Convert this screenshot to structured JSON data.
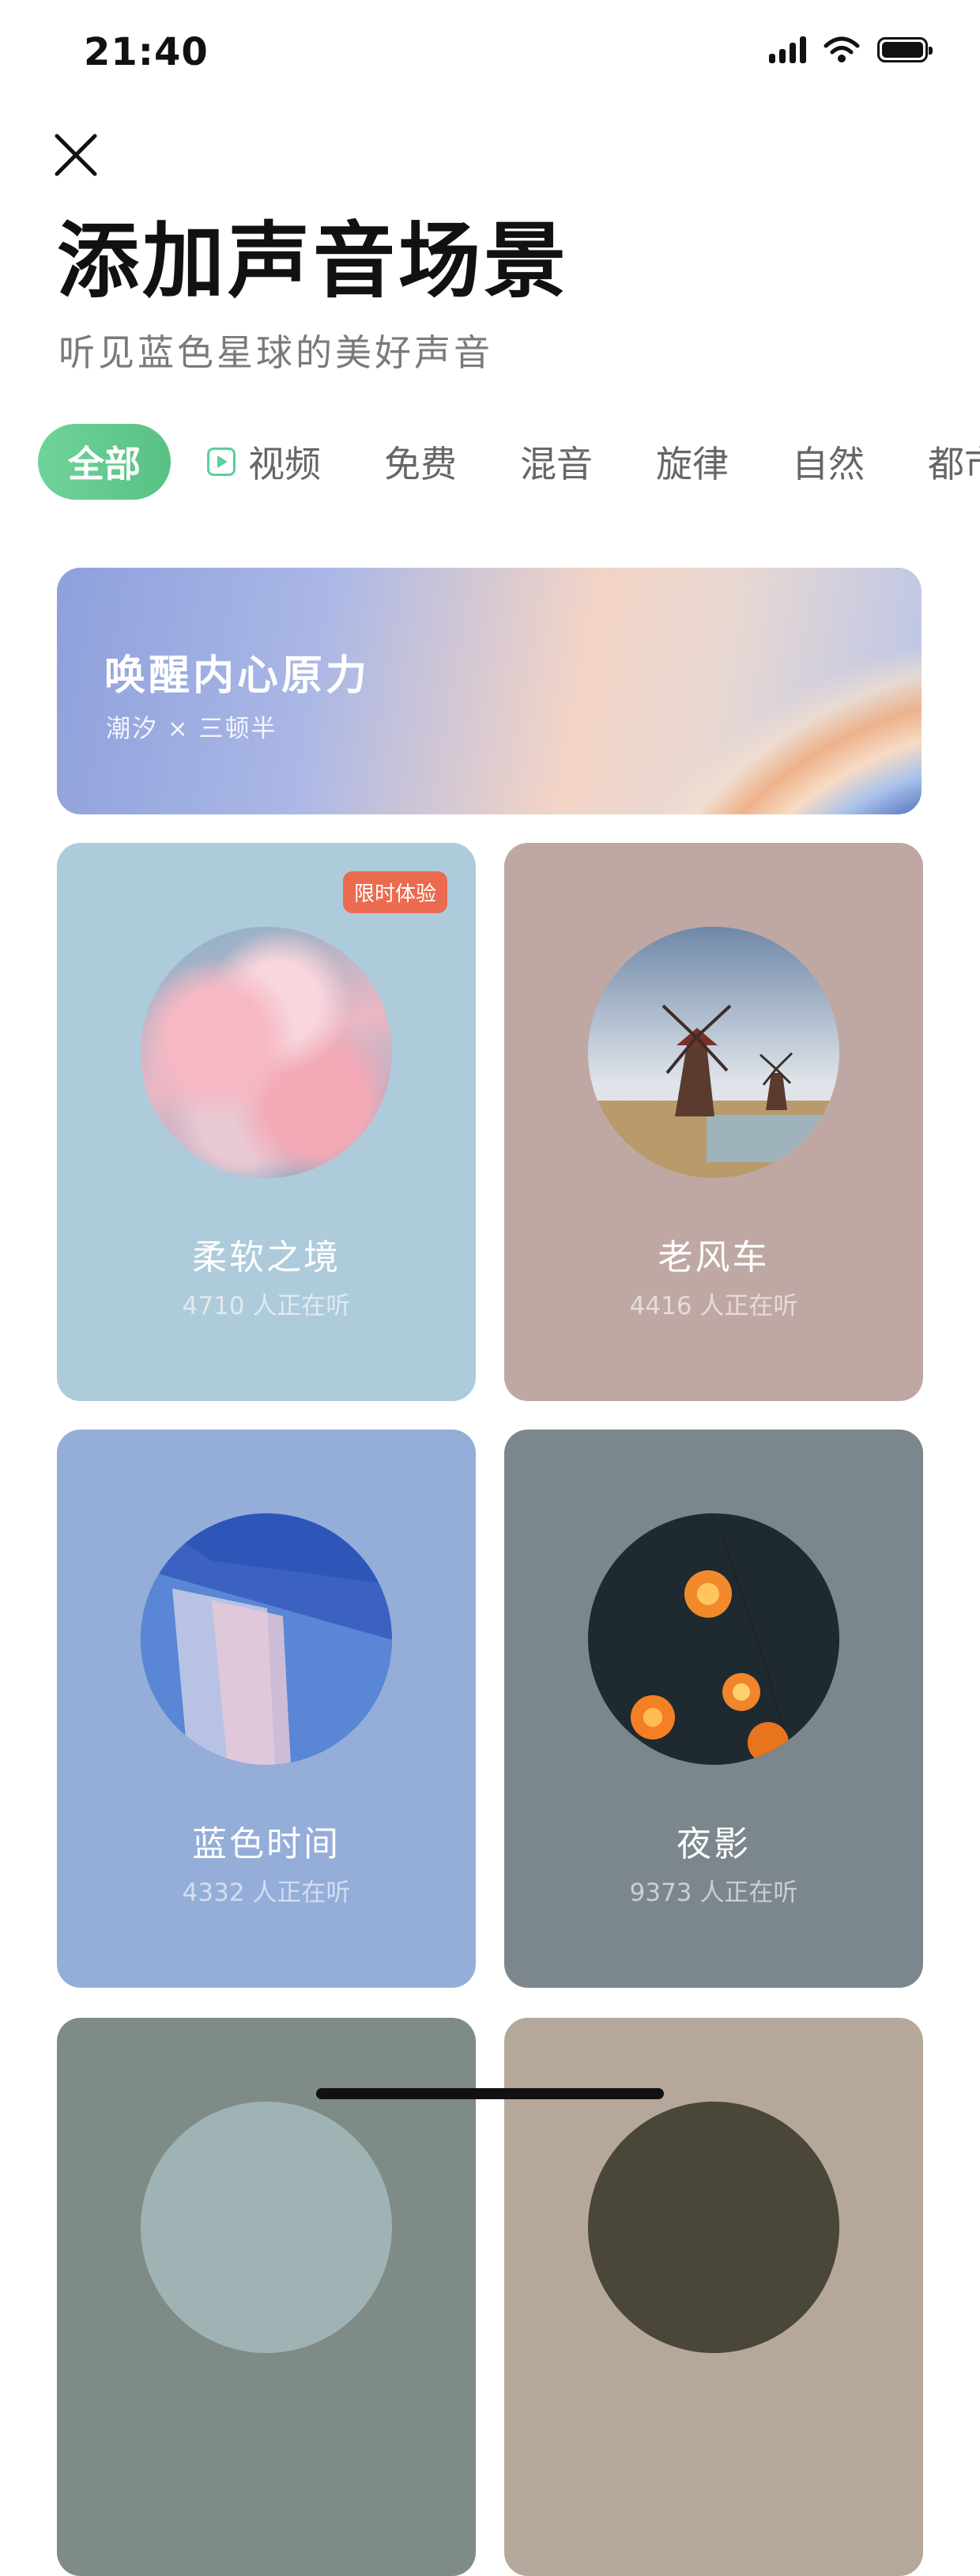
{
  "status": {
    "time": "21:40"
  },
  "header": {
    "title": "添加声音场景",
    "subtitle": "听见蓝色星球的美好声音"
  },
  "tabs": [
    {
      "label": "全部",
      "active": true
    },
    {
      "label": "视频",
      "icon": "video-play-icon"
    },
    {
      "label": "免费"
    },
    {
      "label": "混音"
    },
    {
      "label": "旋律"
    },
    {
      "label": "自然"
    },
    {
      "label": "都市"
    }
  ],
  "banner": {
    "title": "唤醒内心原力",
    "subtitle": "潮汐 × 三顿半"
  },
  "cards": [
    {
      "title": "柔软之境",
      "listeners": "4710 人正在听",
      "badge": "限时体验",
      "bg": "#aecbdb"
    },
    {
      "title": "老风车",
      "listeners": "4416 人正在听",
      "bg": "#bfa8a3"
    },
    {
      "title": "蓝色时间",
      "listeners": "4332 人正在听",
      "bg": "#94add9"
    },
    {
      "title": "夜影",
      "listeners": "9373 人正在听",
      "bg": "#7b878c"
    },
    {
      "bg": "#7f8b86"
    },
    {
      "bg": "#b5a89a"
    }
  ]
}
